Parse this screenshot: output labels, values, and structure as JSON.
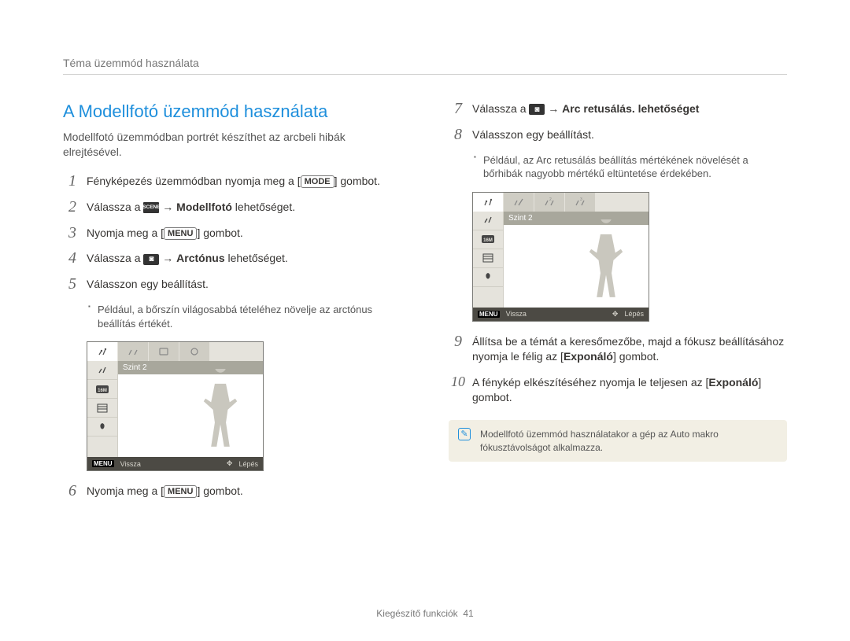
{
  "header": {
    "breadcrumb": "Téma üzemmód használata"
  },
  "section_title": "A Modellfotó üzemmód használata",
  "intro": "Modellfotó üzemmódban portrét készíthet az arcbeli hibák elrejtésével.",
  "steps": {
    "s1_a": "Fényképezés üzemmódban nyomja meg a ",
    "s1_mode": "MODE",
    "s1_b": " gombot.",
    "s2_a": "Válassza a ",
    "s2_scene": "SCENE",
    "s2_b": " → ",
    "s2_bold": "Modellfotó",
    "s2_c": " lehetőséget.",
    "s3_a": "Nyomja meg a ",
    "s3_menu": "MENU",
    "s3_b": " gombot.",
    "s4_a": "Válassza a ",
    "s4_b": " → ",
    "s4_bold": "Arctónus",
    "s4_c": " lehetőséget.",
    "s5": "Válasszon egy beállítást.",
    "s5_bullet": "Például, a bőrszín világosabbá tételéhez növelje az arctónus beállítás értékét.",
    "s6_a": "Nyomja meg a ",
    "s6_menu": "MENU",
    "s6_b": " gombot.",
    "s7_a": "Válassza a ",
    "s7_b": " → ",
    "s7_bold": "Arc retusálás.",
    "s7_c": " lehetőséget",
    "s8": "Válasszon egy beállítást.",
    "s8_bullet": "Például, az Arc retusálás beállítás mértékének növelését a bőrhibák nagyobb mértékű eltüntetése érdekében.",
    "s9_a": "Állítsa be a témát a keresőmezőbe, majd a fókusz beállításához nyomja le félig az [",
    "s9_expo": "Exponáló",
    "s9_b": "] gombot.",
    "s10_a": "A fénykép elkészítéséhez nyomja le teljesen az [",
    "s10_expo": "Exponáló",
    "s10_b": "] gombot."
  },
  "screenshot": {
    "level_label": "Szint 2",
    "footer_menu": "MENU",
    "footer_back": "Vissza",
    "footer_move": "Lépés"
  },
  "note": "Modellfotó üzemmód használatakor a gép az Auto makro fókusztávolságot alkalmazza.",
  "footer": {
    "section": "Kiegészítő funkciók",
    "page": "41"
  }
}
